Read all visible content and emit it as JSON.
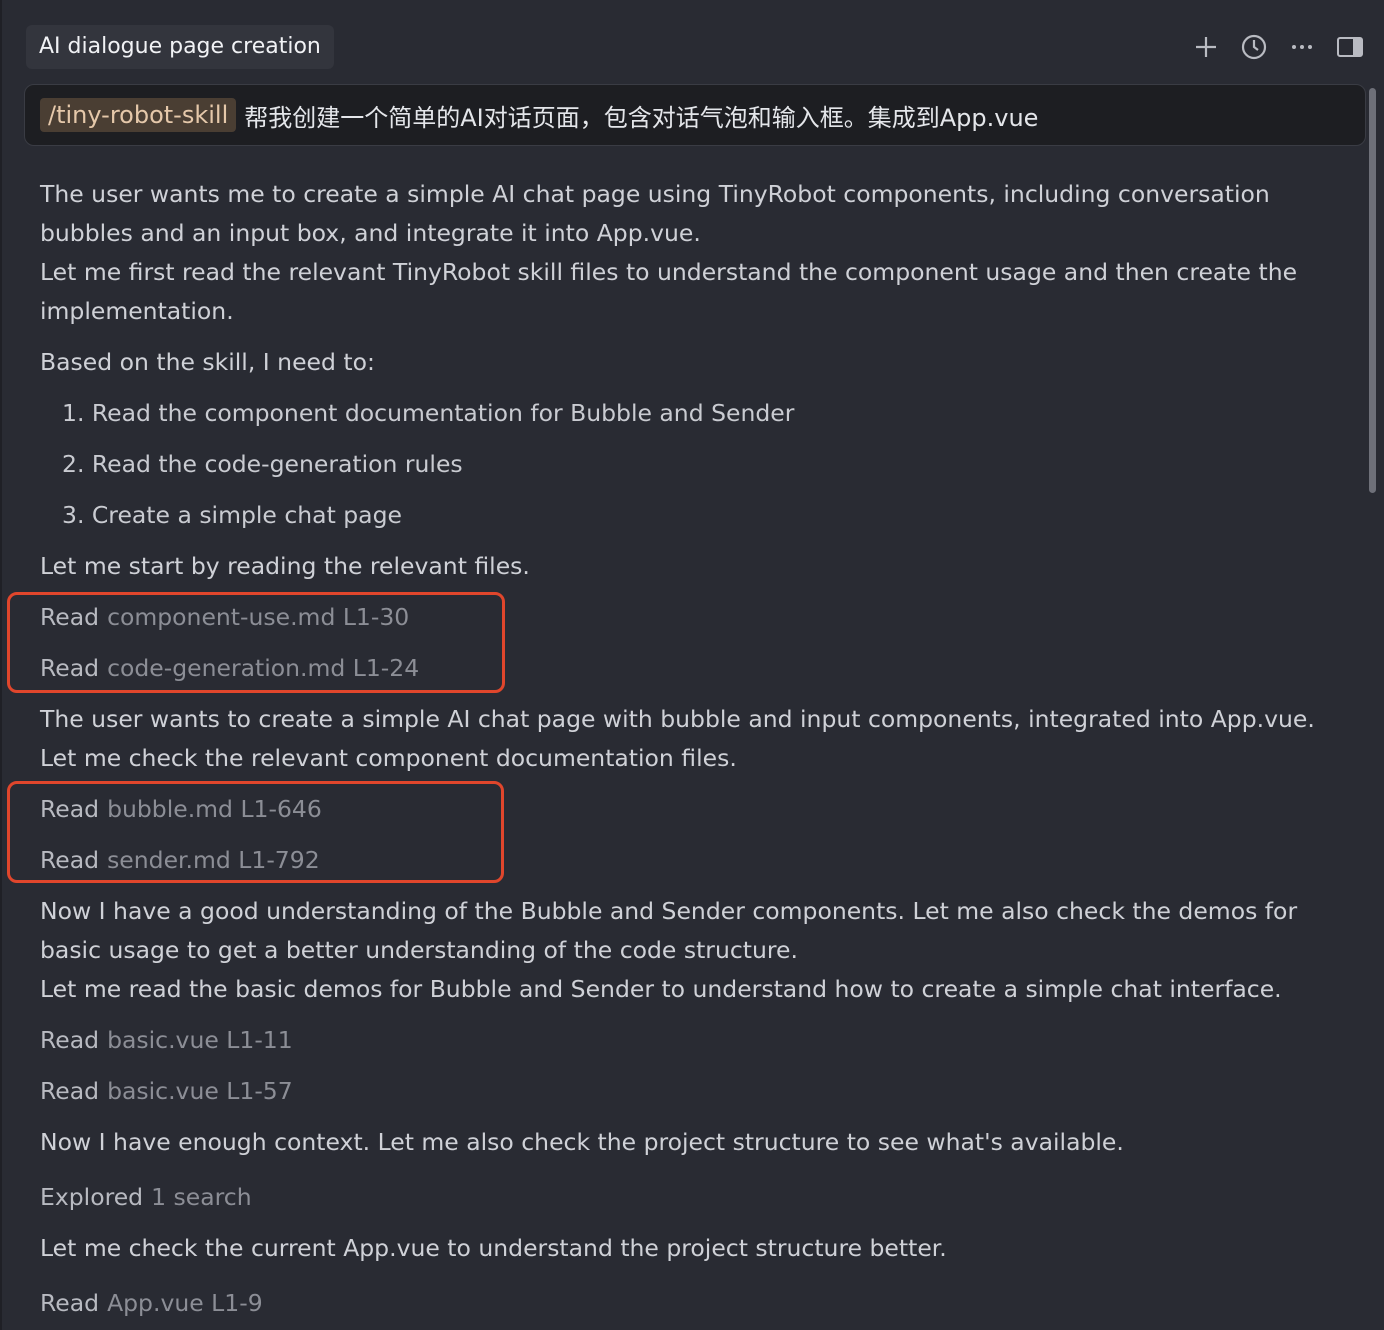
{
  "header": {
    "title": "AI dialogue page creation",
    "icons": [
      "plus-icon",
      "history-icon",
      "more-icon",
      "sidebar-toggle-icon"
    ]
  },
  "prompt": {
    "chip": "/tiny-robot-skill",
    "text": "帮我创建一个简单的AI对话页面，包含对话气泡和输入框。集成到App.vue"
  },
  "messages": {
    "p1_line1": "The user wants me to create a simple AI chat page using TinyRobot components, including conversation bubbles and an input box, and integrate it into App.vue.",
    "p1_line2": "Let me first read the relevant TinyRobot skill files to understand the component usage and then create the implementation.",
    "p2": "Based on the skill, I need to:",
    "list": [
      "1. Read the component documentation for Bubble and Sender",
      "2. Read the code-generation rules",
      "3. Create a simple chat page"
    ],
    "p3": "Let me start by reading the relevant files.",
    "p4_line1": "The user wants to create a simple AI chat page with bubble and input components, integrated into App.vue.",
    "p4_line2": "Let me check the relevant component documentation files.",
    "p5_line1": "Now I have a good understanding of the Bubble and Sender components. Let me also check the demos for basic usage to get a better understanding of the code structure.",
    "p5_line2": "Let me read the basic demos for Bubble and Sender to understand how to create a simple chat interface.",
    "p6": "Now I have enough context. Let me also check the project structure to see what's available.",
    "p7": "Let me check the current App.vue to understand the project structure better."
  },
  "tools": {
    "read_verb": "Read",
    "explored_verb": "Explored",
    "t1": "component-use.md L1-30",
    "t2": "code-generation.md L1-24",
    "t3": "bubble.md L1-646",
    "t4": "sender.md L1-792",
    "t5": "basic.vue L1-11",
    "t6": "basic.vue L1-57",
    "t7": "1 search",
    "t8": "App.vue L1-9"
  },
  "colors": {
    "background": "#292b33",
    "highlight": "#e0462c",
    "chip_bg": "#4a3e33"
  }
}
